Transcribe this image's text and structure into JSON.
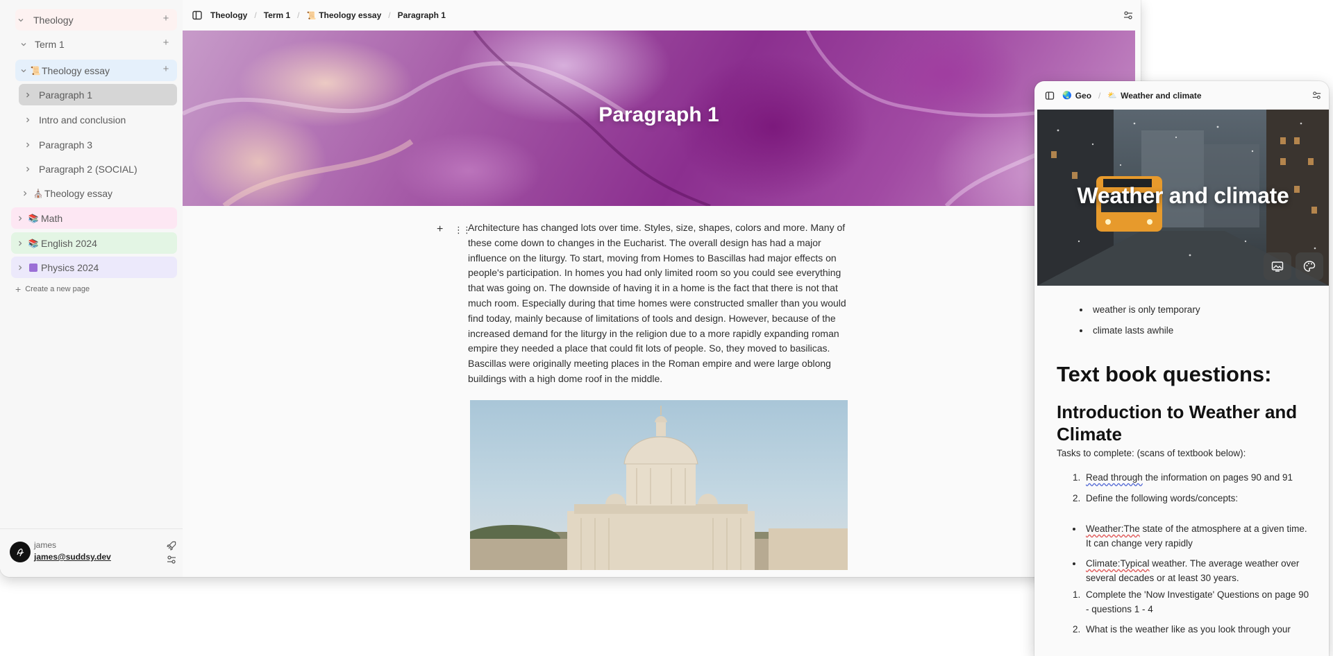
{
  "main": {
    "sidebar": {
      "items": [
        {
          "label": "Theology",
          "emoji": ""
        },
        {
          "label": "Term 1",
          "emoji": ""
        },
        {
          "label": "Theology essay",
          "emoji": "📜"
        },
        {
          "label": "Paragraph 1",
          "emoji": ""
        },
        {
          "label": "Intro and conclusion",
          "emoji": ""
        },
        {
          "label": "Paragraph 3",
          "emoji": ""
        },
        {
          "label": "Paragraph 2 (SOCIAL)",
          "emoji": ""
        },
        {
          "label": "Theology essay",
          "emoji": "⛪"
        },
        {
          "label": "Math",
          "emoji": "📚"
        },
        {
          "label": "English 2024",
          "emoji": "📚"
        },
        {
          "label": "Physics 2024",
          "emoji": "⚛"
        }
      ],
      "create_new_page": "Create a new page",
      "user": {
        "name": "james",
        "email": "james@suddsy.dev"
      },
      "colors": {
        "theology": "#fdf0ef",
        "theology_essay": "#e4f0fb",
        "paragraph_selected": "#d9d9d9",
        "math": "#fde6f3",
        "english": "#e3f5e4",
        "physics": "#ece8fb"
      }
    },
    "breadcrumbs": [
      {
        "label": "Theology"
      },
      {
        "label": "Term 1"
      },
      {
        "label": "Theology essay",
        "emoji": "📜"
      },
      {
        "label": "Paragraph 1"
      }
    ],
    "cover_title": "Paragraph 1",
    "body_text": "Architecture has changed lots over time. Styles, size, shapes, colors and more. Many of these come down to changes in the Eucharist. The overall design has had a major influence on the liturgy. To start, moving from Homes to Bascillas had major effects on people's participation. In homes you had only limited room so you could see everything that was going on. The downside of having it in a home is the fact that there is not that much room. Especially during that time homes were constructed smaller than you would find today, mainly because of limitations of tools and design. However, because of the increased demand for the liturgy in the religion due to a more rapidly expanding roman empire they needed a place that could fit lots of people. So, they moved to basilicas. Bascillas were originally meeting places in the Roman empire and were large oblong buildings with a high dome roof in the middle."
  },
  "side": {
    "breadcrumbs": [
      {
        "label": "Geo",
        "emoji": "🌏"
      },
      {
        "label": "Weather and climate",
        "emoji": "⛅"
      }
    ],
    "cover_title": "Weather and climate",
    "bullets": [
      "weather is only temporary",
      "climate lasts awhile"
    ],
    "heading1": "Text book questions:",
    "heading2": "Introduction to Weather and Climate",
    "tasks_intro": "Tasks to complete: (scans of textbook below):",
    "ol1": [
      {
        "lead": "Read through",
        "rest": " the information on pages 90 and 91"
      },
      {
        "lead": "",
        "rest": "Define the following words/concepts:"
      }
    ],
    "defs": [
      {
        "lead": "Weather:The",
        "rest": " state of the atmosphere at a given time. It can change very rapidly"
      },
      {
        "lead": "Climate:Typical",
        "rest": " weather. The average weather over several decades or at least 30 years."
      }
    ],
    "ol2": [
      "Complete the 'Now Investigate' Questions on page 90 - questions 1 - 4",
      "What is the weather like as you look through your"
    ]
  }
}
